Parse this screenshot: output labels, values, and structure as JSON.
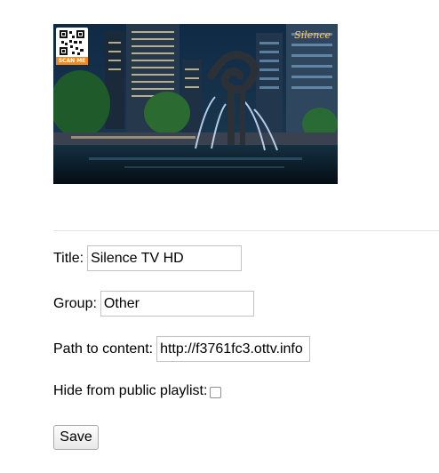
{
  "thumbnail": {
    "qr_label": "SCAN ME",
    "brand_text": "Silence"
  },
  "form": {
    "title_label": "Title:",
    "title_value": "Silence TV HD",
    "group_label": "Group:",
    "group_value": "Other",
    "path_label": "Path to content:",
    "path_value": "http://f3761fc3.ottv.info",
    "hide_label": "Hide from public playlist:",
    "hide_checked": false,
    "save_label": "Save"
  }
}
